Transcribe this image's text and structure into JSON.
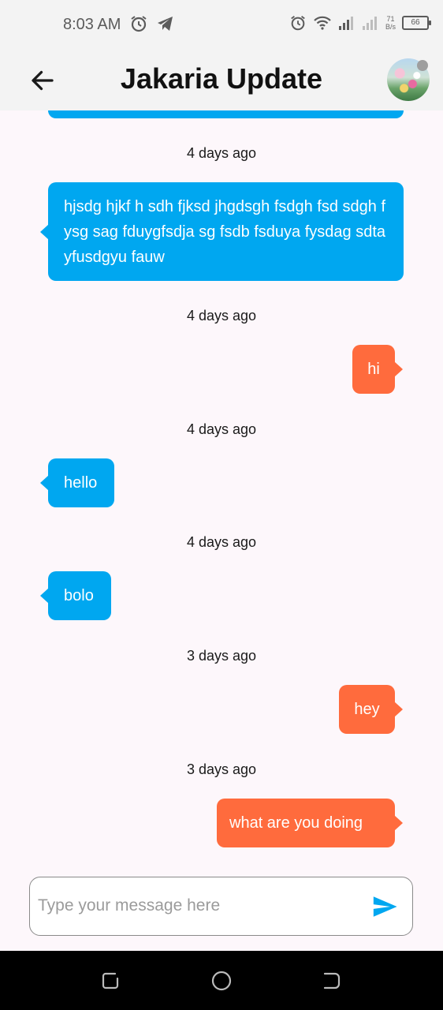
{
  "status_bar": {
    "time": "8:03 AM",
    "left_icons": [
      "alarm-icon",
      "telegram-icon"
    ],
    "right_icons": [
      "alarm-icon",
      "wifi-icon",
      "signal-icon",
      "signal-icon"
    ],
    "net_speed_value": "71",
    "net_speed_unit": "B/s",
    "battery": "66"
  },
  "app_bar": {
    "back_icon": "arrow-left-icon",
    "title": "Jakaria Update",
    "avatar_status_color": "#9e9e9e"
  },
  "messages": [
    {
      "time": "4 days ago",
      "text": "hjsdg hjkf h sdh fjksd jhgdsgh fsdgh fsd sdgh f ysg sag fduygfsdja sg fsdb fsduya fysdag sdta yfusdgyu fauw",
      "direction": "incoming"
    },
    {
      "time": "4 days ago",
      "text": "hi",
      "direction": "outgoing"
    },
    {
      "time": "4 days ago",
      "text": "hello",
      "direction": "incoming"
    },
    {
      "time": "4 days ago",
      "text": "bolo",
      "direction": "incoming"
    },
    {
      "time": "3 days ago",
      "text": "hey",
      "direction": "outgoing"
    },
    {
      "time": "3 days ago",
      "text": "what are you doing",
      "direction": "outgoing"
    }
  ],
  "composer": {
    "placeholder": "Type your message here",
    "send_icon": "send-icon"
  },
  "colors": {
    "incoming": "#00a7f0",
    "outgoing": "#ff6b3d",
    "background": "#fdf7fb",
    "appbar": "#f3f3f3"
  },
  "nav_bar": [
    "recents-icon",
    "home-icon",
    "back-icon"
  ]
}
